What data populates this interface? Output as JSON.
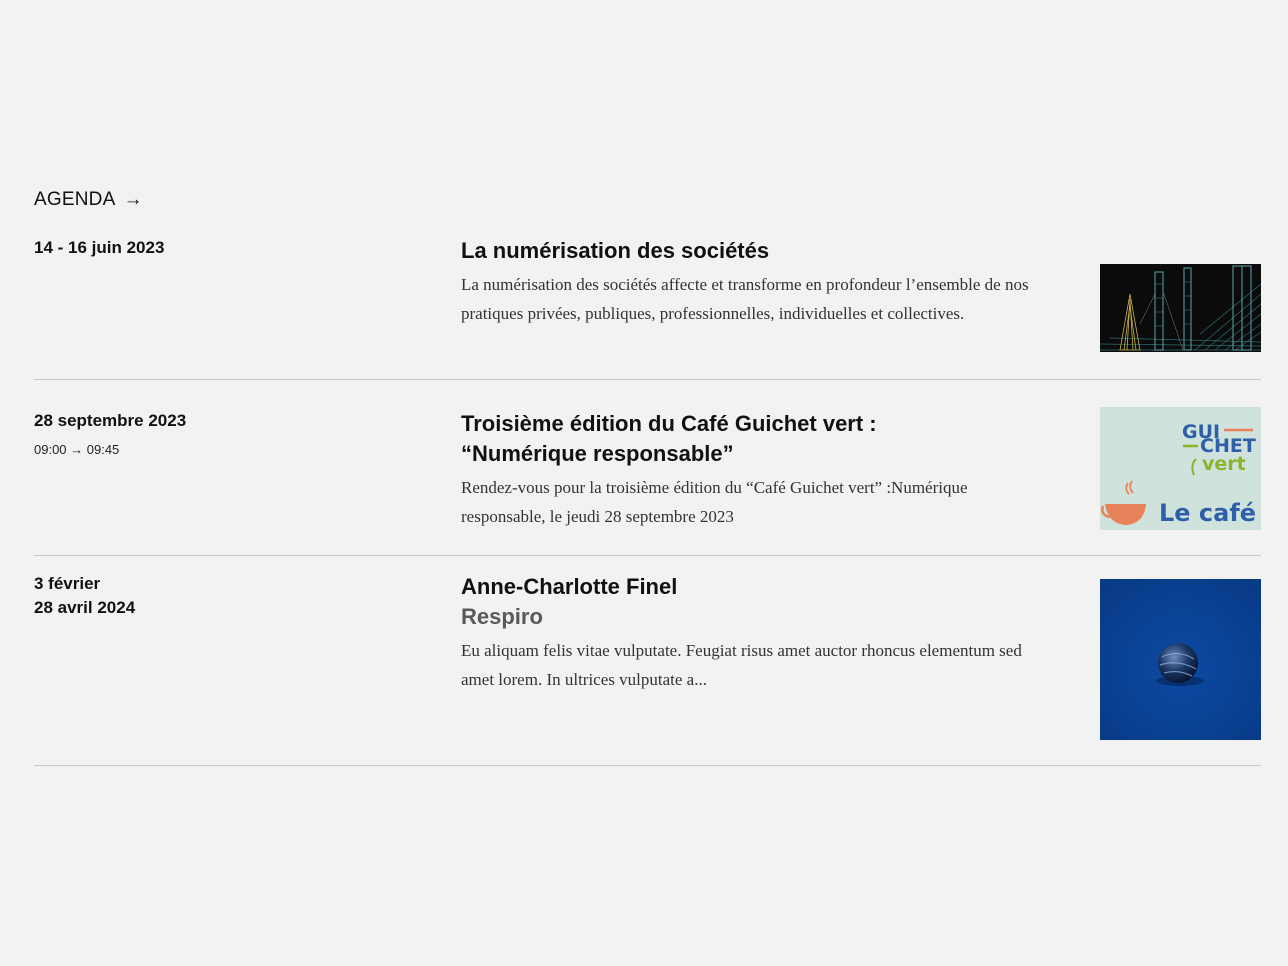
{
  "agenda": {
    "heading": "AGENDA",
    "arrow": "→",
    "events": [
      {
        "date": "14 - 16 juin 2023",
        "title": "La numérisation des sociétés",
        "description": "La numérisation des sociétés affecte et transforme en profondeur l’ensemble de nos pratiques privées, publiques, professionnelles, individuelles et collectives.",
        "image_icon": "city-skyline-image"
      },
      {
        "date": "28 septembre 2023",
        "time": "09:00 → 09:45",
        "title_line1": "Troisième édition du Café Guichet vert :",
        "title_line2": "“Numérique responsable”",
        "description": "Rendez-vous pour la troisième édition du “Café Guichet vert” :Numérique responsable, le jeudi 28 septembre 2023",
        "logo": {
          "line1": "GUI",
          "line2": "CHET",
          "line3": "vert",
          "tagline": "Le café"
        }
      },
      {
        "date_line1": "3 février",
        "date_line2": "28 avril 2024",
        "title": "Anne-Charlotte Finel",
        "subtitle": "Respiro",
        "description": "Eu aliquam felis vitae vulputate. Feugiat risus amet auctor rhoncus elementum sed amet lorem. In ultrices vulputate a...",
        "image_icon": "blue-sphere-image"
      }
    ]
  },
  "colors": {
    "background": "#f2f2f2",
    "divider": "#c9c9c9",
    "logo_blue": "#2f5fa8",
    "logo_green": "#8ab52a",
    "logo_orange": "#e8825a",
    "logo_bg": "#cfe2dc",
    "artwork_blue": "#0a3f91"
  }
}
